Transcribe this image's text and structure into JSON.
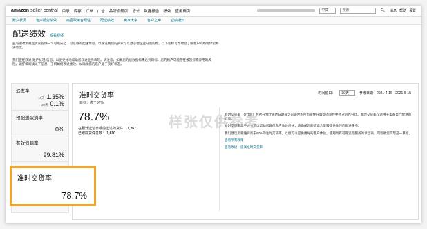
{
  "topnav": {
    "logo_brand": "amazon",
    "logo_sub": "seller central",
    "items": [
      "目录",
      "库存",
      "订单",
      "广告",
      "品牌旗舰店",
      "增长",
      "数据报告",
      "绩效",
      "应用商店"
    ],
    "language": "中文",
    "search_placeholder": "搜索",
    "links": [
      "消息",
      "帮助",
      "设置"
    ]
  },
  "subnav": {
    "items": [
      "账户状况",
      "客户服务绩效",
      "商品政策合规性",
      "配送绩效",
      "卖家大学",
      "客户之声",
      "业绩通知"
    ]
  },
  "page": {
    "title": "配送绩效",
    "learn_more": "观看视频",
    "desc1": "亚马逊政策规定卖家提供一个可靠安全、可信赖的配送体验，以保证我们的买家可以放心地在亚马逊购物。以下指标可帮助您了解客户的购物体验和满意度。",
    "desc2": "我们正在改进“账户状况”信息。以便更好地帮助您改进业务表现。请注意，如果您的绩效指标未达到目标，您的账户可能存在被暂停或停用的风险。请仔细阅读以下信息，了解如何改进绩效，以确保您的账户处于良好状态。"
  },
  "metrics": {
    "late_rate": {
      "name": "迟发率",
      "rows": [
        {
          "k": "10天",
          "v": "1.35%"
        },
        {
          "k": "30天",
          "v": "0.1%"
        }
      ]
    },
    "cancel_rate": {
      "name": "预配送取消率",
      "value": "0%"
    },
    "valid_tracking": {
      "name": "有效追踪率",
      "value": "99.81%"
    }
  },
  "detail": {
    "title": "准时交货率",
    "target": "目标：高于97%",
    "period_label": "时间窗口：",
    "period_value": "30天",
    "date_range": "参考日期：2021-4-16 - 2021-5-15",
    "value": "78.7%",
    "stat1_label": "在预计送达日期前送达的货件：",
    "stat1_value": "1,267",
    "stat2_label": "已跟踪货件总数：",
    "stat2_value": "1,610",
    "explain1": "准时交货率（OTDR）包括在预计送达日期或之前送达的所有货件在跟踪的货件中所占的百分比。准时交货率仅适用于卖家自行配送的订单。",
    "explain2": "准时交货率高于97%可以帮助您确保客户体验良好，请确保您的承运人能够提供准时的配送服务。",
    "explain3": "我们建议卖家维持高于97%的准时交货率。以便可以提供更好的客户体验。使用具有可靠追踪服务的承运商，可帮助您实现这一目标。",
    "link1": "查看所有政策",
    "link2": "查看改进：提高准时交货率"
  },
  "highlight": {
    "name": "准时交货率",
    "value": "78.7%"
  },
  "watermark": "样张仅供参考",
  "colors": {
    "accent": "#f5a623",
    "link": "#007185"
  }
}
